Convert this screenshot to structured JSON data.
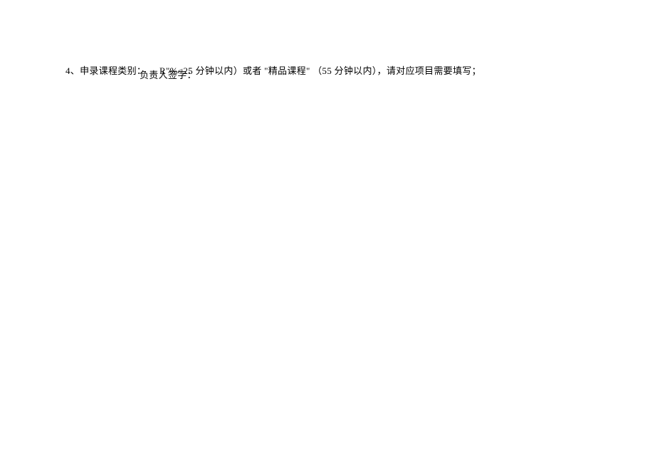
{
  "document": {
    "line1_prefix": "4、申录课程类别：",
    "overlap_text": "R\"%<25 分钟以内）或者 \"精品课程\" （55 分钟以内），请对应项目需要填写；",
    "line2_text": "负责人签字："
  }
}
